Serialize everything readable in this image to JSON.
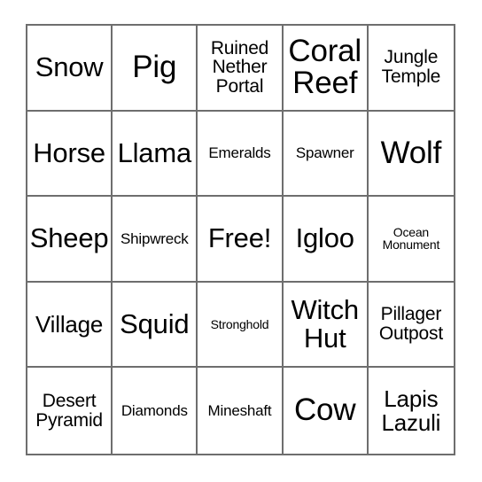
{
  "card": {
    "type": "bingo-card",
    "columns": 5,
    "rows": 5,
    "background_color": "#ffffff",
    "grid_line_color": "#6e6e6e",
    "text_color": "#000000",
    "free_space_label": "Free!",
    "free_space_index": 12,
    "cells": [
      {
        "label": "Snow",
        "size": "lg"
      },
      {
        "label": "Pig",
        "size": "xl"
      },
      {
        "label": "Ruined\nNether\nPortal",
        "size": "sm"
      },
      {
        "label": "Coral\nReef",
        "size": "xl"
      },
      {
        "label": "Jungle\nTemple",
        "size": "sm"
      },
      {
        "label": "Horse",
        "size": "lg"
      },
      {
        "label": "Llama",
        "size": "lg"
      },
      {
        "label": "Emeralds",
        "size": "xs"
      },
      {
        "label": "Spawner",
        "size": "xs"
      },
      {
        "label": "Wolf",
        "size": "xl"
      },
      {
        "label": "Sheep",
        "size": "lg"
      },
      {
        "label": "Shipwreck",
        "size": "xs"
      },
      {
        "label": "Free!",
        "size": "lg"
      },
      {
        "label": "Igloo",
        "size": "lg"
      },
      {
        "label": "Ocean\nMonument",
        "size": "xxs"
      },
      {
        "label": "Village",
        "size": "md"
      },
      {
        "label": "Squid",
        "size": "lg"
      },
      {
        "label": "Stronghold",
        "size": "xxs"
      },
      {
        "label": "Witch\nHut",
        "size": "lg"
      },
      {
        "label": "Pillager\nOutpost",
        "size": "sm"
      },
      {
        "label": "Desert\nPyramid",
        "size": "sm"
      },
      {
        "label": "Diamonds",
        "size": "xs"
      },
      {
        "label": "Mineshaft",
        "size": "xs"
      },
      {
        "label": "Cow",
        "size": "xl"
      },
      {
        "label": "Lapis\nLazuli",
        "size": "md"
      }
    ]
  }
}
